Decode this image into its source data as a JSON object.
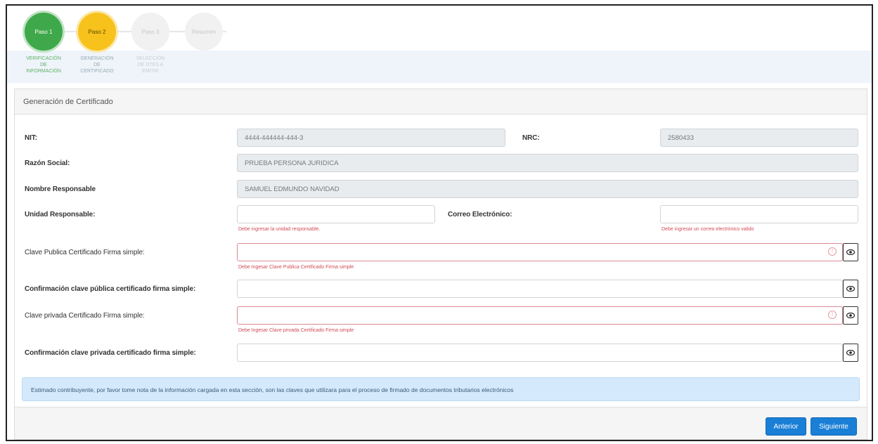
{
  "stepper": {
    "steps": [
      {
        "circle": "Paso 1",
        "label_lines": [
          "VERIFICACIÓN",
          "DE",
          "INFORMACIÓN"
        ],
        "state": "done"
      },
      {
        "circle": "Paso 2",
        "label_lines": [
          "GENERACIÓN",
          "DE",
          "CERTIFICADO"
        ],
        "state": "active"
      },
      {
        "circle": "Paso 3",
        "label_lines": [
          "SELECCIÓN",
          "DE DTES A",
          "EMITIR"
        ],
        "state": "pending"
      },
      {
        "circle": "Resumen",
        "label_lines": [],
        "state": "pending"
      }
    ]
  },
  "card": {
    "title": "Generación de Certificado",
    "nit": {
      "label": "NIT:",
      "value": "4444-444444-444-3"
    },
    "nrc": {
      "label": "NRC:",
      "value": "2580433"
    },
    "razon": {
      "label": "Razón Social:",
      "value": "PRUEBA PERSONA JURIDICA"
    },
    "nombre": {
      "label": "Nombre Responsable",
      "value": "SAMUEL EDMUNDO NAVIDAD"
    },
    "unidad": {
      "label": "Unidad Responsable:",
      "value": "",
      "error": "Debe ingresar la unidad responsable."
    },
    "correo": {
      "label": "Correo Electrónico:",
      "value": "",
      "error": "Debe ingresar un correo electrónico valido"
    },
    "clave_publica": {
      "label": "Clave Publica Certificado Firma simple:",
      "value": "",
      "error": "Debe Ingesar Clave Publica Certificado Firma simple"
    },
    "conf_publica": {
      "label": "Confirmación clave pública certificado firma simple:",
      "value": ""
    },
    "clave_privada": {
      "label": "Clave privada Certificado Firma simple:",
      "value": "",
      "error": "Debe Ingesar Clave privada Certificado Firma simple"
    },
    "conf_privada": {
      "label": "Confirmación clave privada certificado firma simple:",
      "value": ""
    },
    "note": "Estimado contribuyente, por favor tome nota de la información cargada en esta sección, son las claves que utilizara para el proceso de firmado de documentos tributarios electrónicos"
  },
  "footer": {
    "prev_label": "Anterior",
    "next_label": "Siguiente"
  },
  "colors": {
    "accent": "#1a7fd6",
    "done": "#3fa84a",
    "active": "#f7c21c",
    "error": "#d04b56"
  }
}
